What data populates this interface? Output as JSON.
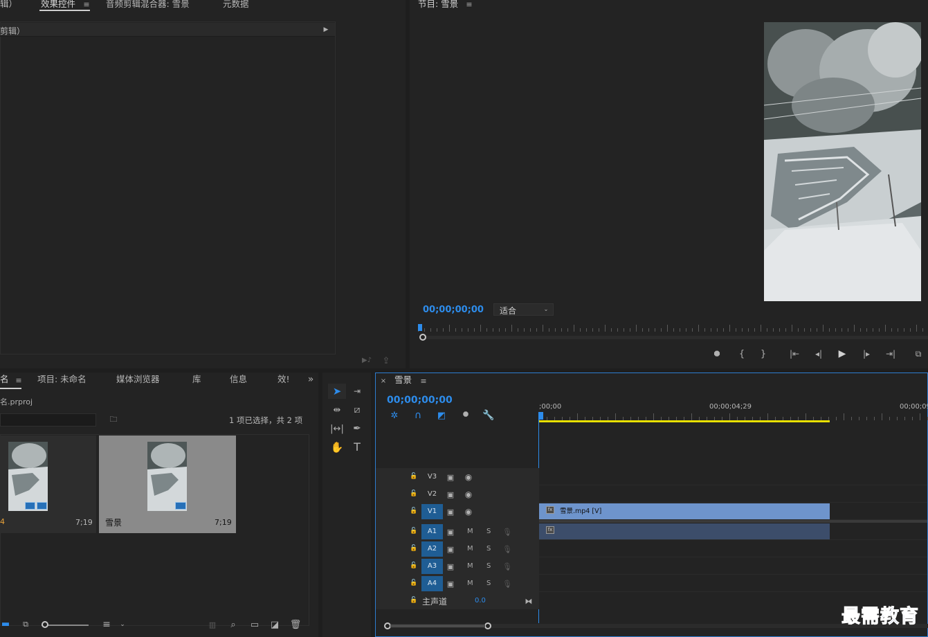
{
  "top_left": {
    "tabs": [
      "辑）",
      "效果控件",
      "音频剪辑混合器: 雪景",
      "元数据"
    ],
    "header_label": "剪辑）"
  },
  "program": {
    "tab_title": "节目: 雪景",
    "timecode": "00;00;00;00",
    "fit_label": "适合"
  },
  "project": {
    "tabs": [
      "名",
      "项目: 未命名",
      "媒体浏览器",
      "库",
      "信息",
      "效!"
    ],
    "project_file": "名.prproj",
    "selection_info": "1 项已选择，共 2 项",
    "items": [
      {
        "name": "4",
        "duration": "7;19"
      },
      {
        "name": "雪景",
        "duration": "7;19"
      }
    ]
  },
  "timeline": {
    "tab_title": "雪景",
    "timecode": "00;00;00;00",
    "ruler_labels": [
      ";00;00",
      "00;00;04;29",
      "00;00;09"
    ],
    "video_tracks": [
      "V3",
      "V2",
      "V1"
    ],
    "audio_tracks": [
      "A1",
      "A2",
      "A3",
      "A4"
    ],
    "mute_label": "M",
    "solo_label": "S",
    "master_label": "主声道",
    "master_value": "0.0",
    "video_clip_label": "雪景.mp4 [V]",
    "fx_badge": "fx"
  },
  "watermark": "最需教育",
  "colors": {
    "accent_blue": "#2d8ceb",
    "track_target_blue": "#1f5d94",
    "video_clip": "#6e94cc",
    "audio_clip": "#3c4d6a",
    "work_area": "#e8e000"
  }
}
